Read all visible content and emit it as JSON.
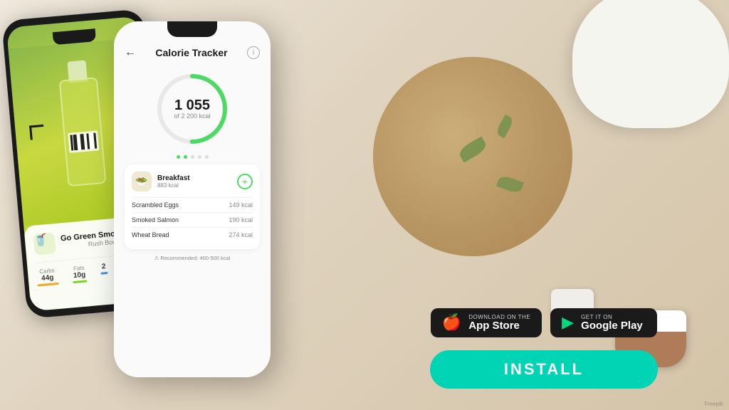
{
  "background": {
    "color": "#e8ddd0"
  },
  "app": {
    "title": "Calorie Tracker",
    "back_label": "←",
    "info_label": "i",
    "calorie_current": "1 055",
    "calorie_of": "of",
    "calorie_goal": "2 200 kcal",
    "progress_percent": 48,
    "dots": [
      true,
      true,
      false,
      false,
      false
    ]
  },
  "meal": {
    "icon": "🥗",
    "name": "Breakfast",
    "kcal": "883 kcal",
    "add_label": "+"
  },
  "food_items": [
    {
      "name": "Scrambled Eggs",
      "kcal": "149 kcal"
    },
    {
      "name": "Smoked Salmon",
      "kcal": "190 kcal"
    },
    {
      "name": "Wheat Bread",
      "kcal": "274 kcal"
    }
  ],
  "recommended": "⚠ Recommended: 400-500 kcal",
  "product": {
    "name": "Go Green Smoothie",
    "brand": "Rush Bowls",
    "icon": "🥤",
    "macros": [
      {
        "label": "Carbs",
        "value": "44g",
        "color": "#f5a623"
      },
      {
        "label": "Fats",
        "value": "10g",
        "color": "#7ed321"
      },
      {
        "label": "",
        "value": "2",
        "color": "#4a90e2"
      }
    ]
  },
  "store_buttons": {
    "apple": {
      "sub": "Download on the",
      "main": "App Store",
      "icon": "🍎"
    },
    "google": {
      "sub": "GET IT ON",
      "main": "Google Play",
      "icon": "▶"
    }
  },
  "install": {
    "label": "INSTALL"
  },
  "watermark": "Freepik"
}
